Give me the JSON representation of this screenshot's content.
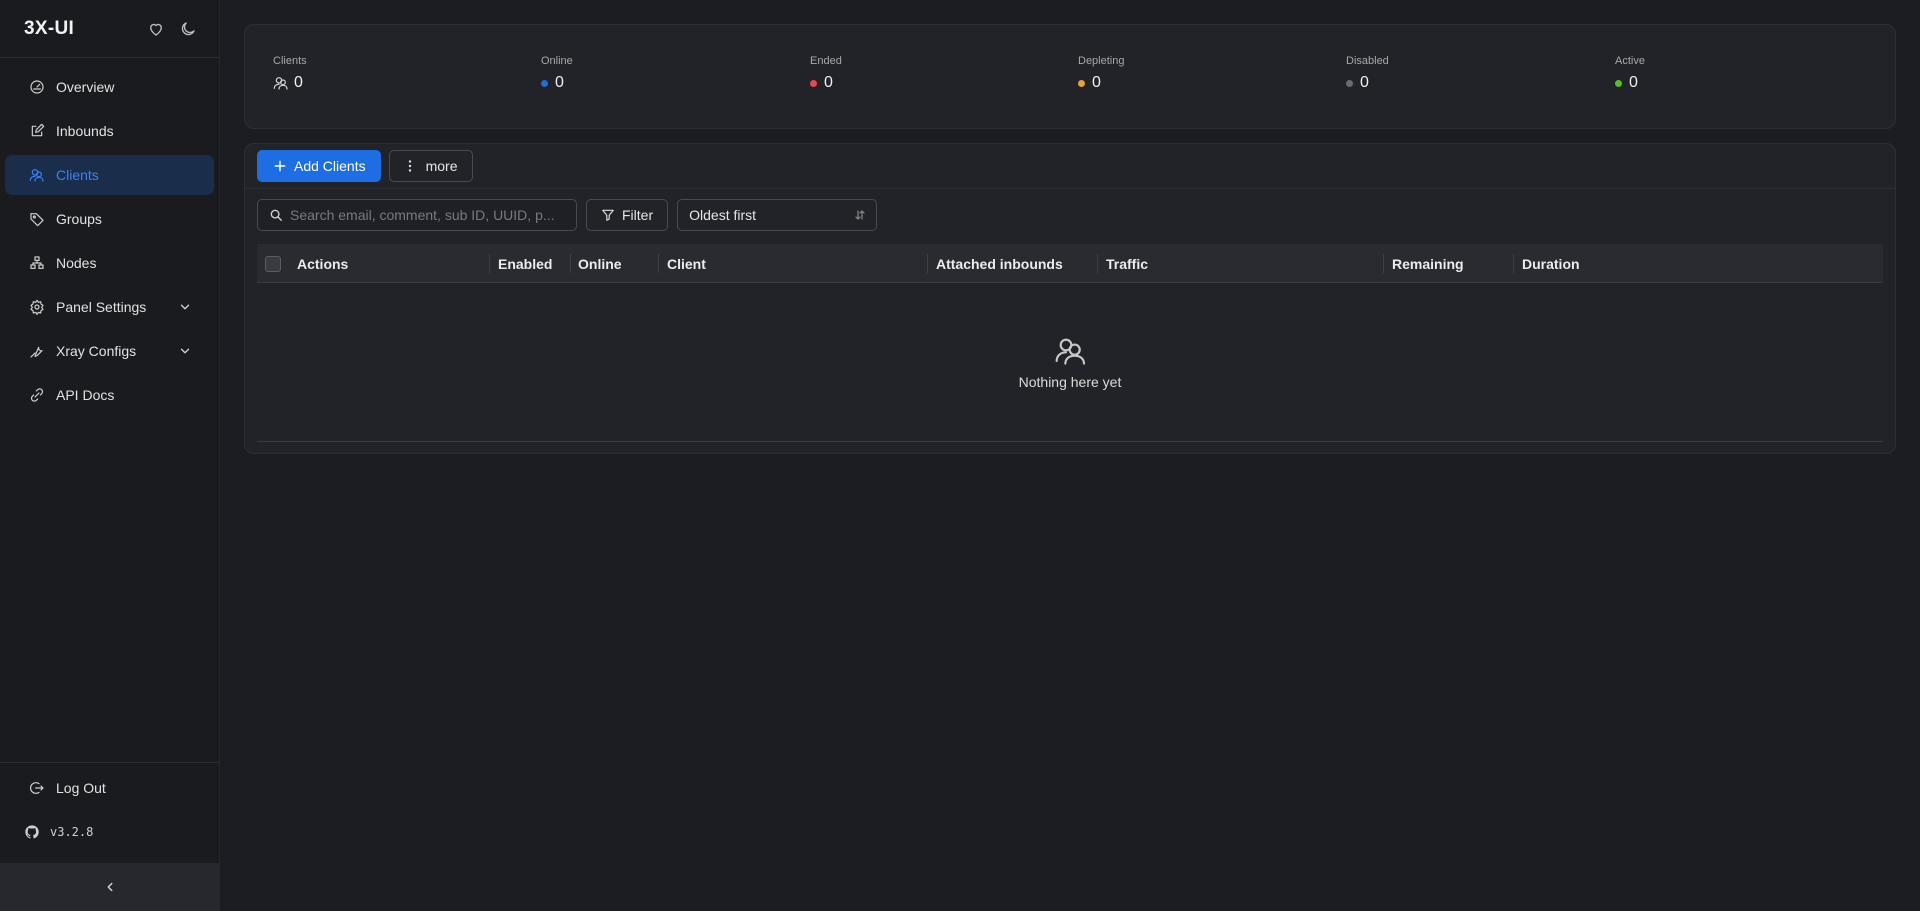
{
  "app": {
    "title": "3X-UI"
  },
  "sidebar": {
    "items": [
      {
        "label": "Overview",
        "icon": "dashboard-icon"
      },
      {
        "label": "Inbounds",
        "icon": "edit-icon"
      },
      {
        "label": "Clients",
        "icon": "users-icon",
        "active": true
      },
      {
        "label": "Groups",
        "icon": "tag-icon"
      },
      {
        "label": "Nodes",
        "icon": "cluster-icon"
      },
      {
        "label": "Panel Settings",
        "icon": "gear-icon",
        "expandable": true
      },
      {
        "label": "Xray Configs",
        "icon": "tool-icon",
        "expandable": true
      },
      {
        "label": "API Docs",
        "icon": "api-icon"
      }
    ],
    "logout_label": "Log Out",
    "version": "v3.2.8"
  },
  "stats": [
    {
      "label": "Clients",
      "value": "0",
      "indicator": "users-icon"
    },
    {
      "label": "Online",
      "value": "0",
      "color": "#1d6ee3"
    },
    {
      "label": "Ended",
      "value": "0",
      "color": "#e5484d"
    },
    {
      "label": "Depleting",
      "value": "0",
      "color": "#e8a23a"
    },
    {
      "label": "Disabled",
      "value": "0",
      "color": "#6b6c72"
    },
    {
      "label": "Active",
      "value": "0",
      "color": "#52c41a"
    }
  ],
  "toolbar": {
    "add_label": "Add Clients",
    "more_label": "more"
  },
  "filters": {
    "search_placeholder": "Search email, comment, sub ID, UUID, p...",
    "filter_label": "Filter",
    "sort_value": "Oldest first"
  },
  "table": {
    "columns": [
      "Actions",
      "Enabled",
      "Online",
      "Client",
      "Attached inbounds",
      "Traffic",
      "Remaining",
      "Duration"
    ],
    "empty_text": "Nothing here yet"
  },
  "colors": {
    "accent": "#1d6ee3",
    "active_nav_bg": "#1a2d4a"
  }
}
